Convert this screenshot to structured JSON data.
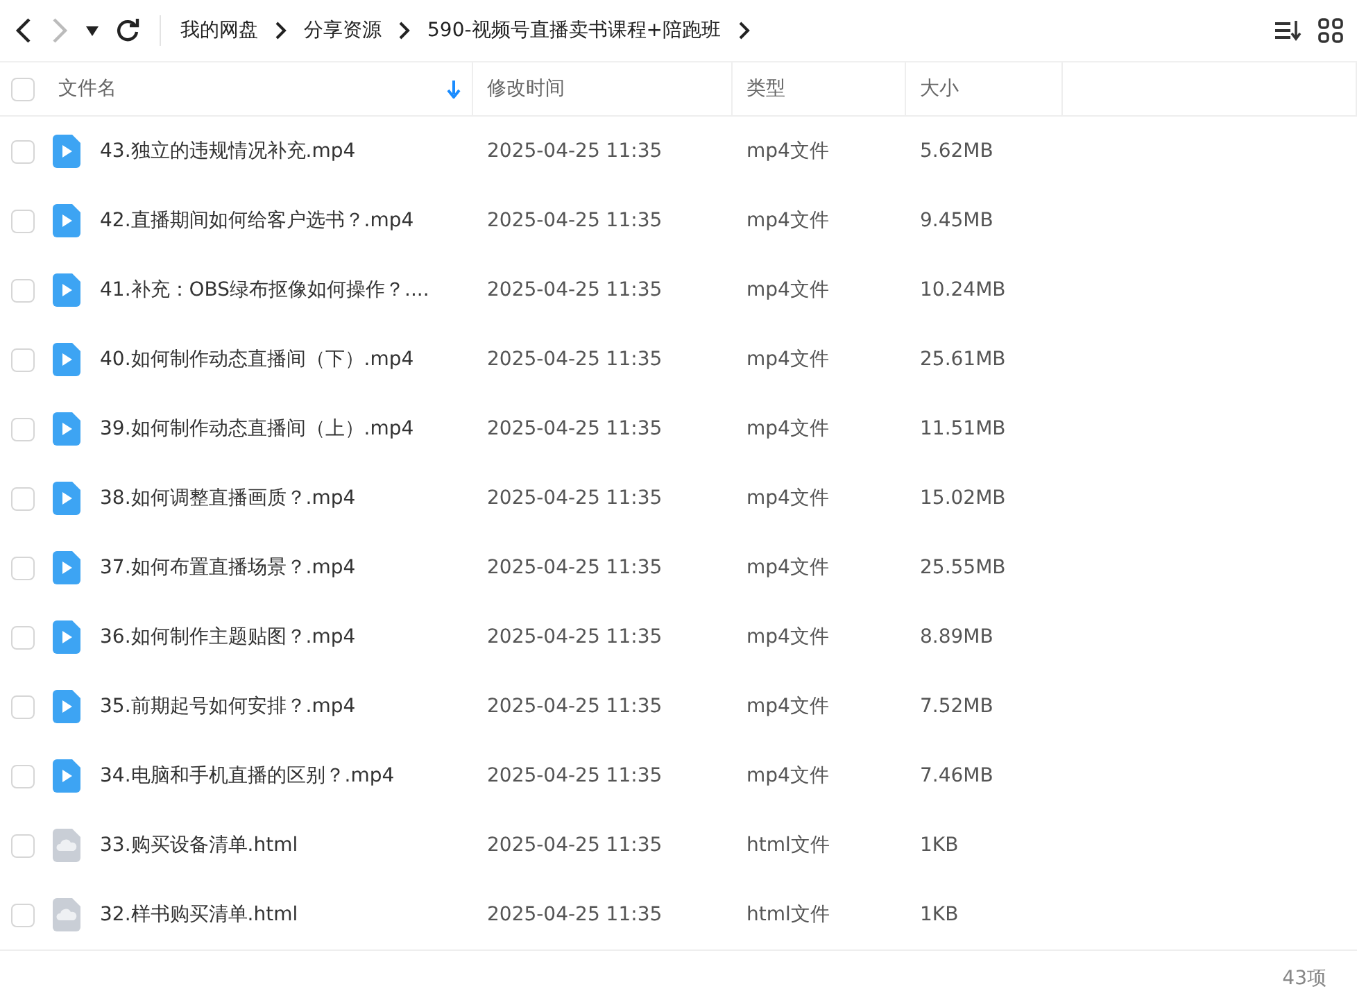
{
  "toolbar": {
    "back_disabled": false,
    "forward_disabled": true,
    "breadcrumbs": [
      "我的网盘",
      "分享资源",
      "590-视频号直播卖书课程+陪跑班"
    ]
  },
  "table": {
    "select_all": {
      "checked": false
    },
    "columns": [
      {
        "label": "文件名",
        "sorted": true
      },
      {
        "label": "修改时间",
        "sorted": false
      },
      {
        "label": "类型",
        "sorted": false
      },
      {
        "label": "大小",
        "sorted": false
      }
    ],
    "rows": [
      {
        "checked": false,
        "kind": "video",
        "name": "43.独立的违规情况补充.mp4",
        "modified": "2025-04-25 11:35",
        "type": "mp4文件",
        "size": "5.62MB"
      },
      {
        "checked": false,
        "kind": "video",
        "name": "42.直播期间如何给客户选书？.mp4",
        "modified": "2025-04-25 11:35",
        "type": "mp4文件",
        "size": "9.45MB"
      },
      {
        "checked": false,
        "kind": "video",
        "name": "41.补充：OBS绿布抠像如何操作？....",
        "modified": "2025-04-25 11:35",
        "type": "mp4文件",
        "size": "10.24MB"
      },
      {
        "checked": false,
        "kind": "video",
        "name": "40.如何制作动态直播间（下）.mp4",
        "modified": "2025-04-25 11:35",
        "type": "mp4文件",
        "size": "25.61MB"
      },
      {
        "checked": false,
        "kind": "video",
        "name": "39.如何制作动态直播间（上）.mp4",
        "modified": "2025-04-25 11:35",
        "type": "mp4文件",
        "size": "11.51MB"
      },
      {
        "checked": false,
        "kind": "video",
        "name": "38.如何调整直播画质？.mp4",
        "modified": "2025-04-25 11:35",
        "type": "mp4文件",
        "size": "15.02MB"
      },
      {
        "checked": false,
        "kind": "video",
        "name": "37.如何布置直播场景？.mp4",
        "modified": "2025-04-25 11:35",
        "type": "mp4文件",
        "size": "25.55MB"
      },
      {
        "checked": false,
        "kind": "video",
        "name": "36.如何制作主题贴图？.mp4",
        "modified": "2025-04-25 11:35",
        "type": "mp4文件",
        "size": "8.89MB"
      },
      {
        "checked": false,
        "kind": "video",
        "name": "35.前期起号如何安排？.mp4",
        "modified": "2025-04-25 11:35",
        "type": "mp4文件",
        "size": "7.52MB"
      },
      {
        "checked": false,
        "kind": "video",
        "name": "34.电脑和手机直播的区别？.mp4",
        "modified": "2025-04-25 11:35",
        "type": "mp4文件",
        "size": "7.46MB"
      },
      {
        "checked": false,
        "kind": "html",
        "name": "33.购买设备清单.html",
        "modified": "2025-04-25 11:35",
        "type": "html文件",
        "size": "1KB"
      },
      {
        "checked": false,
        "kind": "html",
        "name": "32.样书购买清单.html",
        "modified": "2025-04-25 11:35",
        "type": "html文件",
        "size": "1KB"
      }
    ]
  },
  "status_bar": {
    "count": "43项"
  }
}
